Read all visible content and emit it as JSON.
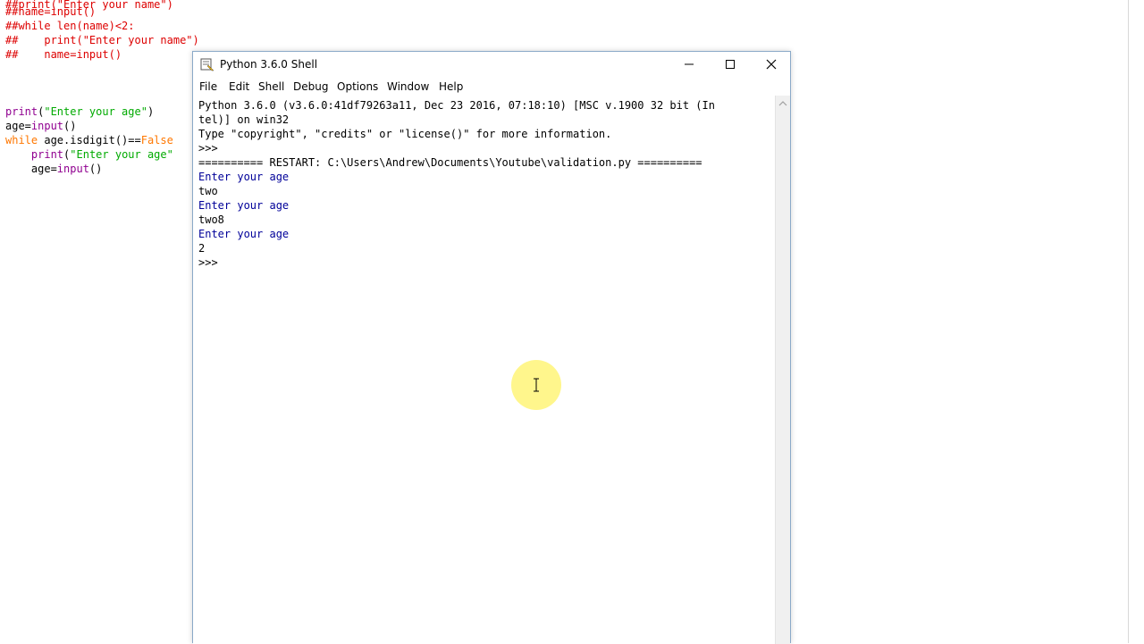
{
  "editor": {
    "lines": [
      {
        "cls": "c-comment",
        "text": "##print(\"Enter your name\")"
      },
      {
        "cls": "c-comment",
        "text": "##name=input()"
      },
      {
        "cls": "c-comment",
        "text": "##while len(name)<2:"
      },
      {
        "cls": "c-comment",
        "text": "##    print(\"Enter your name\")"
      },
      {
        "cls": "c-comment",
        "text": "##    name=input()"
      },
      {
        "parts": [
          {
            "cls": "c-builtin",
            "text": "print"
          },
          {
            "text": "("
          },
          {
            "cls": "c-str",
            "text": "\"Enter your age\""
          },
          {
            "text": ")"
          }
        ]
      },
      {
        "parts": [
          {
            "text": "age="
          },
          {
            "cls": "c-builtin",
            "text": "input"
          },
          {
            "text": "()"
          }
        ]
      },
      {
        "parts": [
          {
            "cls": "c-kw",
            "text": "while"
          },
          {
            "text": " age.isdigit()=="
          },
          {
            "cls": "c-kw",
            "text": "False"
          }
        ]
      },
      {
        "parts": [
          {
            "text": "    "
          },
          {
            "cls": "c-builtin",
            "text": "print"
          },
          {
            "text": "("
          },
          {
            "cls": "c-str",
            "text": "\"Enter your age\""
          }
        ]
      },
      {
        "parts": [
          {
            "text": "    age="
          },
          {
            "cls": "c-builtin",
            "text": "input"
          },
          {
            "text": "()"
          }
        ]
      }
    ]
  },
  "shell": {
    "title": "Python 3.6.0 Shell",
    "menu": [
      "File",
      "Edit",
      "Shell",
      "Debug",
      "Options",
      "Window",
      "Help"
    ],
    "output": [
      {
        "text": "Python 3.6.0 (v3.6.0:41df79263a11, Dec 23 2016, 07:18:10) [MSC v.1900 32 bit (In"
      },
      {
        "text": "tel)] on win32"
      },
      {
        "text": "Type \"copyright\", \"credits\" or \"license()\" for more information."
      },
      {
        "text": ">>>"
      },
      {
        "text": "========== RESTART: C:\\Users\\Andrew\\Documents\\Youtube\\validation.py =========="
      },
      {
        "text": "Enter your age",
        "cls": "out-blue"
      },
      {
        "text": "two"
      },
      {
        "text": "Enter your age",
        "cls": "out-blue"
      },
      {
        "text": "two8"
      },
      {
        "text": "Enter your age",
        "cls": "out-blue"
      },
      {
        "text": "2"
      },
      {
        "text": ">>>"
      }
    ]
  },
  "icons": {
    "app": "python-icon",
    "minimize": "minimize-icon",
    "maximize": "maximize-icon",
    "close": "close-icon",
    "scroll_up": "scroll-up-arrow-icon",
    "text_cursor": "text-cursor-icon"
  }
}
